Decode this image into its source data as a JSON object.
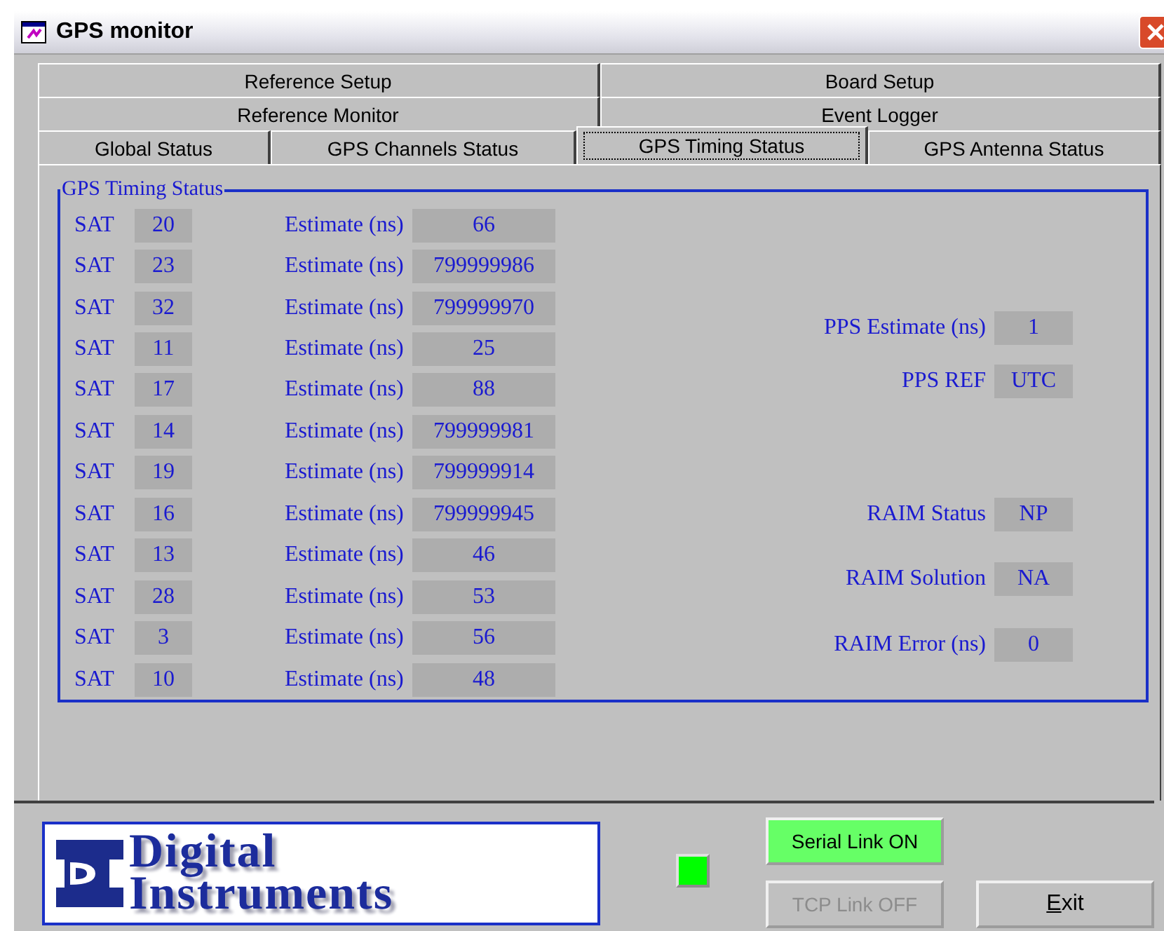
{
  "window": {
    "title": "GPS monitor"
  },
  "tab_rows": [
    [
      {
        "label": "Reference Setup",
        "selected": false
      },
      {
        "label": "Board Setup",
        "selected": false
      }
    ],
    [
      {
        "label": "Reference Monitor",
        "selected": false
      },
      {
        "label": "Event Logger",
        "selected": false
      }
    ],
    [
      {
        "label": "Global Status",
        "selected": false
      },
      {
        "label": "GPS Channels Status",
        "selected": false
      },
      {
        "label": "GPS Timing Status",
        "selected": true
      },
      {
        "label": "GPS Antenna Status",
        "selected": false
      }
    ]
  ],
  "group": {
    "title": "GPS Timing Status",
    "satellites": [
      {
        "sat_label": "SAT",
        "sat": "20",
        "estimate_label": "Estimate (ns)",
        "estimate": "66"
      },
      {
        "sat_label": "SAT",
        "sat": "23",
        "estimate_label": "Estimate (ns)",
        "estimate": "799999986"
      },
      {
        "sat_label": "SAT",
        "sat": "32",
        "estimate_label": "Estimate (ns)",
        "estimate": "799999970"
      },
      {
        "sat_label": "SAT",
        "sat": "11",
        "estimate_label": "Estimate (ns)",
        "estimate": "25"
      },
      {
        "sat_label": "SAT",
        "sat": "17",
        "estimate_label": "Estimate (ns)",
        "estimate": "88"
      },
      {
        "sat_label": "SAT",
        "sat": "14",
        "estimate_label": "Estimate (ns)",
        "estimate": "799999981"
      },
      {
        "sat_label": "SAT",
        "sat": "19",
        "estimate_label": "Estimate (ns)",
        "estimate": "799999914"
      },
      {
        "sat_label": "SAT",
        "sat": "16",
        "estimate_label": "Estimate (ns)",
        "estimate": "799999945"
      },
      {
        "sat_label": "SAT",
        "sat": "13",
        "estimate_label": "Estimate (ns)",
        "estimate": "46"
      },
      {
        "sat_label": "SAT",
        "sat": "28",
        "estimate_label": "Estimate (ns)",
        "estimate": "53"
      },
      {
        "sat_label": "SAT",
        "sat": "3",
        "estimate_label": "Estimate (ns)",
        "estimate": "56"
      },
      {
        "sat_label": "SAT",
        "sat": "10",
        "estimate_label": "Estimate (ns)",
        "estimate": "48"
      }
    ],
    "fields": [
      {
        "label": "PPS Estimate (ns)",
        "value": "1"
      },
      {
        "label": "PPS REF",
        "value": "UTC"
      },
      {
        "label": "RAIM Status",
        "value": "NP"
      },
      {
        "label": "RAIM Solution",
        "value": "NA"
      },
      {
        "label": "RAIM Error (ns)",
        "value": "0"
      }
    ]
  },
  "logo": {
    "text_1": "Digital",
    "text_2": "Instruments"
  },
  "led": {
    "on": true
  },
  "links": [
    {
      "label": "Serial Link ON",
      "on": true,
      "disabled": false
    },
    {
      "label": "TCP Link OFF",
      "on": false,
      "disabled": true
    }
  ],
  "exit_button": "Exit"
}
